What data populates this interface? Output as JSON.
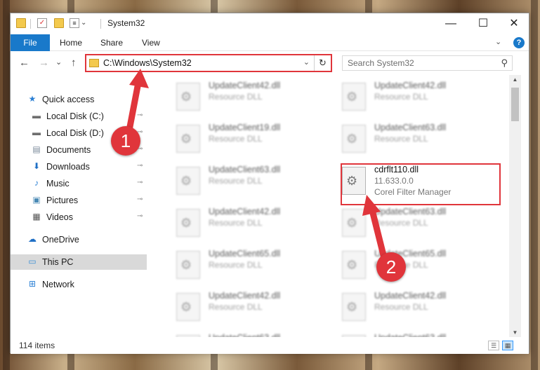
{
  "window": {
    "title": "System32",
    "controls": {
      "minimize": "—",
      "maximize": "☐",
      "close": "✕"
    }
  },
  "ribbon": {
    "tabs": [
      "File",
      "Share",
      "View"
    ],
    "home_tab": "Home",
    "expand_glyph": "⌄",
    "help_glyph": "?"
  },
  "nav": {
    "back_glyph": "←",
    "forward_glyph": "→",
    "recent_glyph": "⌄",
    "up_glyph": "↑",
    "address": "C:\\Windows\\System32",
    "address_chevron": "⌄",
    "refresh_glyph": "↻",
    "search_placeholder": "Search System32",
    "search_glyph": "⚲"
  },
  "sidebar": {
    "items": [
      {
        "label": "Quick access",
        "icon": "star-icon",
        "glyph": "★",
        "color": "#2a7fd4",
        "pinned": false
      },
      {
        "label": "Local Disk (C:)",
        "icon": "drive-icon",
        "glyph": "▬",
        "color": "#6e6e6e",
        "pinned": true
      },
      {
        "label": "Local Disk (D:)",
        "icon": "drive-icon",
        "glyph": "▬",
        "color": "#6e6e6e",
        "pinned": true
      },
      {
        "label": "Documents",
        "icon": "documents-icon",
        "glyph": "▤",
        "color": "#7a8a9a",
        "pinned": true
      },
      {
        "label": "Downloads",
        "icon": "download-icon",
        "glyph": "⬇",
        "color": "#1f6fc5",
        "pinned": true
      },
      {
        "label": "Music",
        "icon": "music-icon",
        "glyph": "♪",
        "color": "#2a7fd4",
        "pinned": true
      },
      {
        "label": "Pictures",
        "icon": "pictures-icon",
        "glyph": "▣",
        "color": "#4a8ab5",
        "pinned": true
      },
      {
        "label": "Videos",
        "icon": "videos-icon",
        "glyph": "▦",
        "color": "#555555",
        "pinned": true
      },
      {
        "label": "OneDrive",
        "icon": "cloud-icon",
        "glyph": "☁",
        "color": "#1f6fc5",
        "pinned": false
      },
      {
        "label": "This PC",
        "icon": "computer-icon",
        "glyph": "▭",
        "color": "#3a8fd6",
        "pinned": false
      },
      {
        "label": "Network",
        "icon": "network-icon",
        "glyph": "⊞",
        "color": "#2a7fd4",
        "pinned": false
      }
    ],
    "pin_glyph": "📌"
  },
  "files": {
    "left_column": [
      {
        "name": "UpdateClient42.dll",
        "desc": "Resource DLL"
      },
      {
        "name": "UpdateClient19.dll",
        "desc": "Resource DLL"
      },
      {
        "name": "UpdateClient63.dll",
        "desc": "Resource DLL"
      },
      {
        "name": "UpdateClient42.dll",
        "desc": "Resource DLL"
      },
      {
        "name": "UpdateClient65.dll",
        "desc": "Resource DLL"
      },
      {
        "name": "UpdateClient42.dll",
        "desc": "Resource DLL"
      },
      {
        "name": "UpdateClient63.dll",
        "desc": "Resource DLL"
      }
    ],
    "right_column": [
      {
        "name": "UpdateClient42.dll",
        "desc": "Resource DLL"
      },
      {
        "name": "UpdateClient63.dll",
        "desc": "Resource DLL"
      },
      {
        "name": "cdrflt110.dll",
        "version": "11.633.0.0",
        "desc": "Corel Filter Manager",
        "highlighted": true
      },
      {
        "name": "UpdateClient63.dll",
        "desc": "Resource DLL"
      },
      {
        "name": "UpdateClient65.dll",
        "desc": "Resource DLL"
      },
      {
        "name": "UpdateClient42.dll",
        "desc": "Resource DLL"
      },
      {
        "name": "UpdateClient63.dll",
        "desc": "Resource DLL"
      }
    ],
    "gear_glyph": "⚙"
  },
  "scrollbar": {
    "up_glyph": "▲",
    "down_glyph": "▼"
  },
  "status": {
    "item_count": "114 items",
    "details_view_glyph": "☰",
    "tiles_view_glyph": "▦"
  },
  "annotations": {
    "marker1": "1",
    "marker2": "2",
    "color": "#e0353b"
  }
}
